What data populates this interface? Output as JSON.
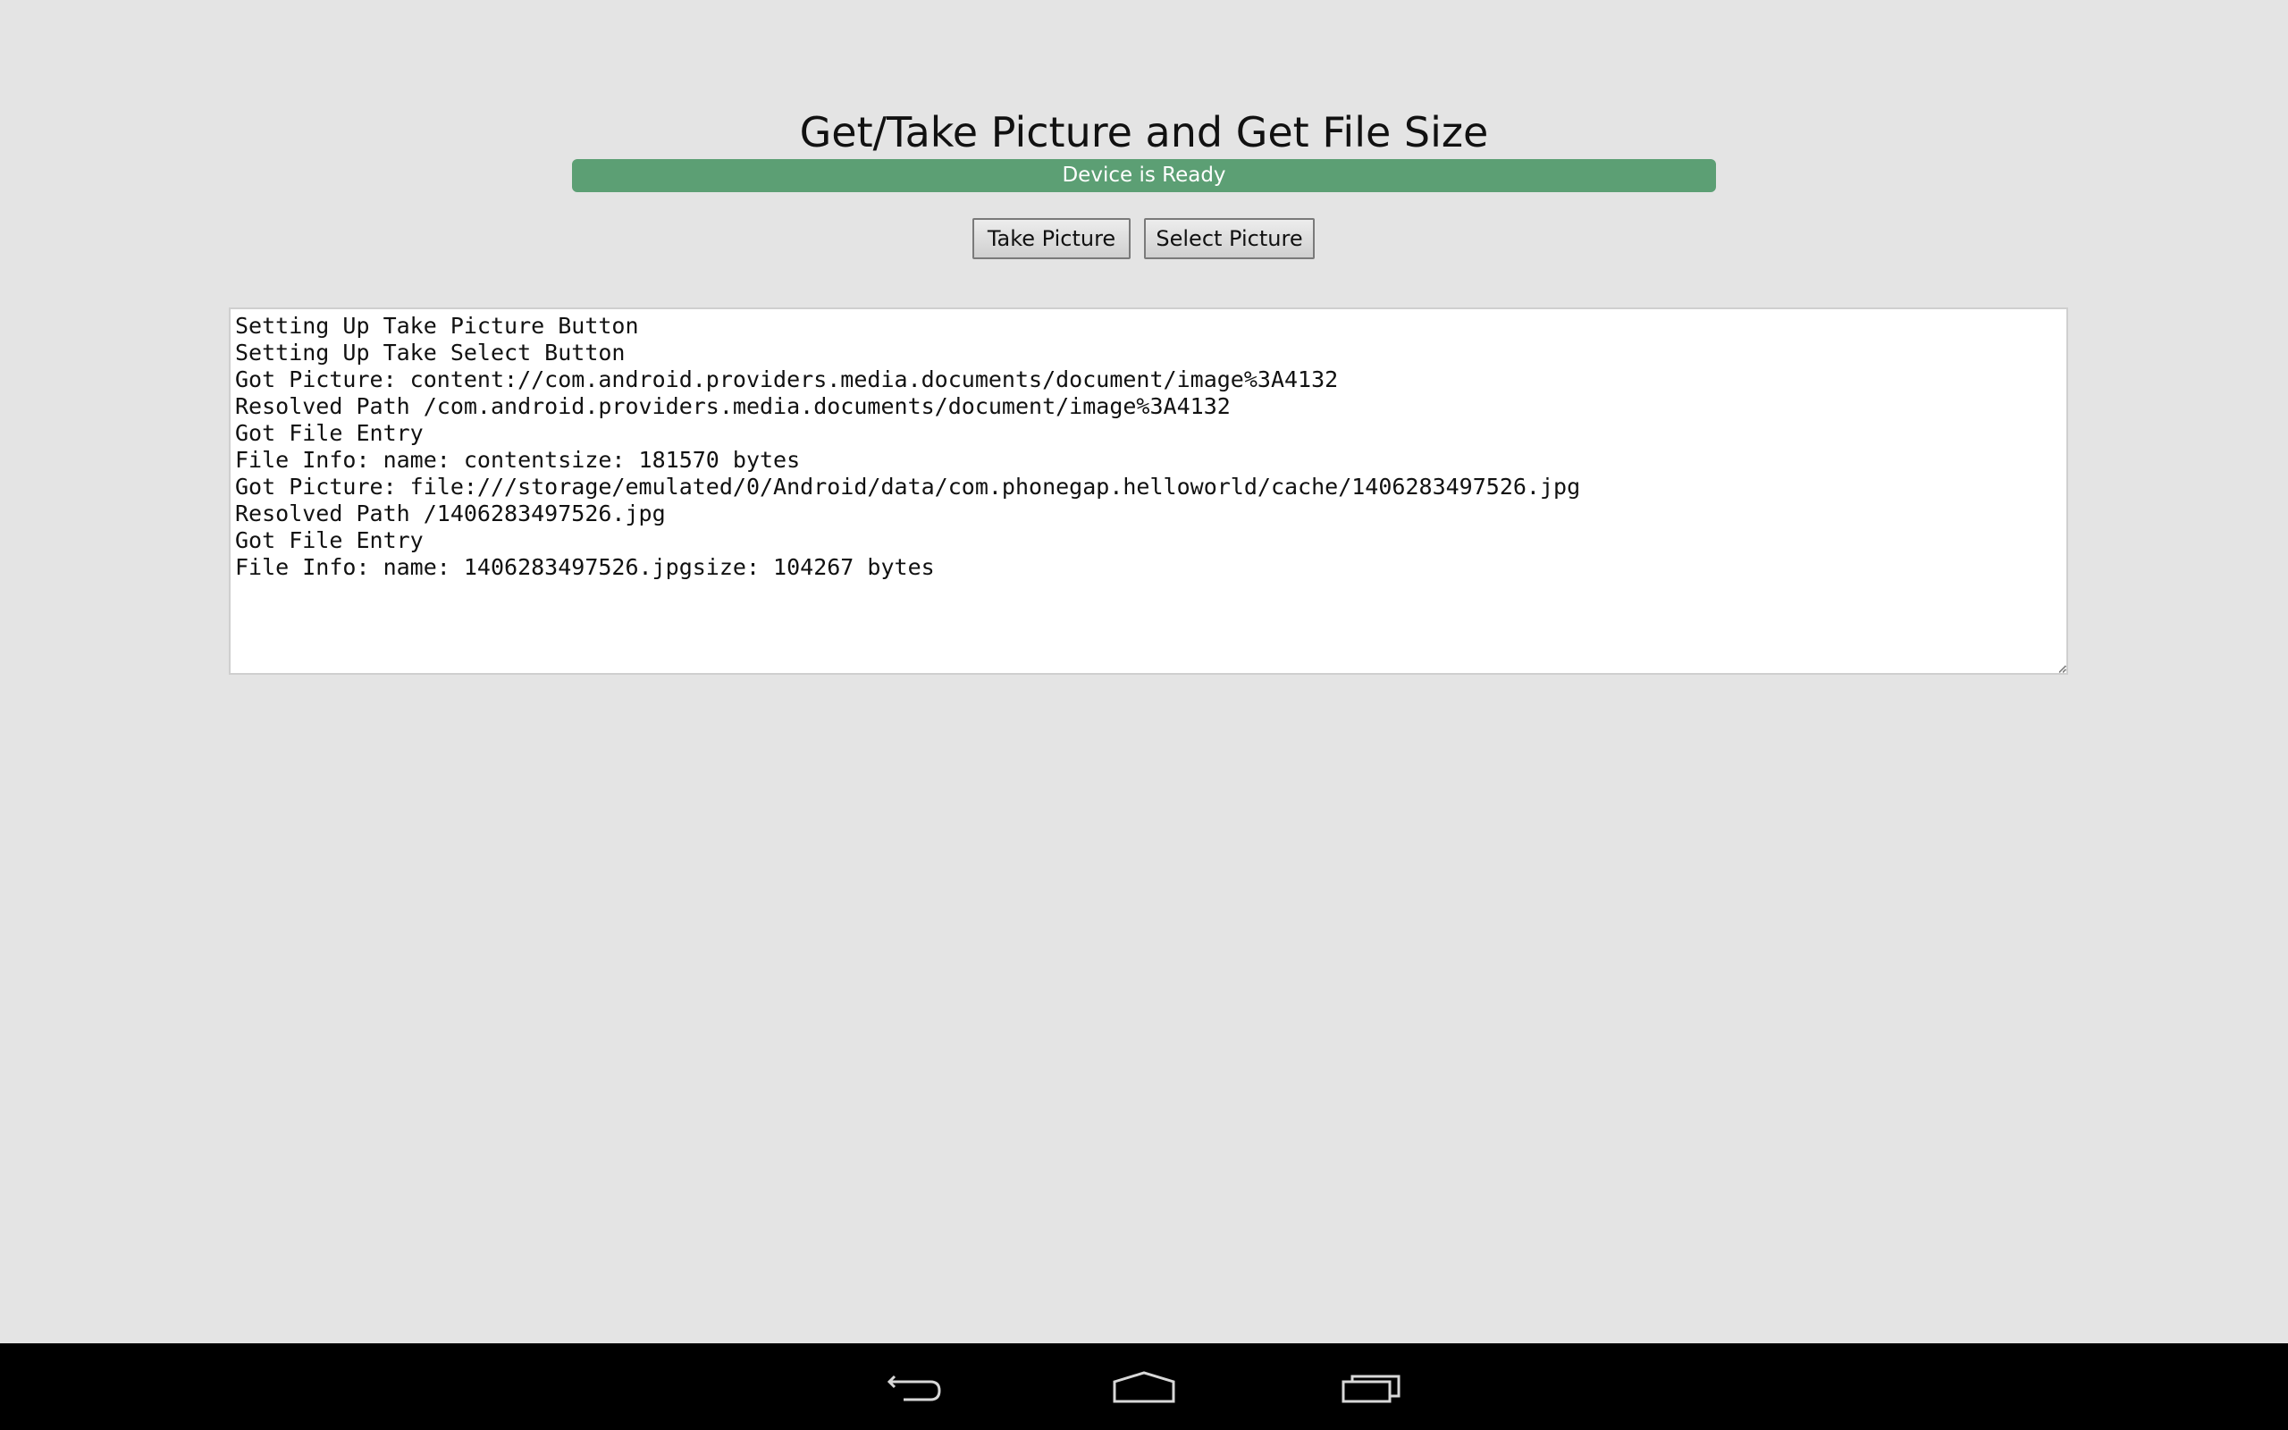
{
  "app": {
    "title": "Get/Take Picture and Get File Size",
    "status": "Device is Ready",
    "status_color": "#5c9f74",
    "buttons": {
      "take_picture": "Take Picture",
      "select_picture": "Select Picture"
    },
    "log_lines": [
      "Setting Up Take Picture Button",
      "Setting Up Take Select Button",
      "Got Picture: content://com.android.providers.media.documents/document/image%3A4132",
      "Resolved Path /com.android.providers.media.documents/document/image%3A4132",
      "Got File Entry",
      "File Info: name: contentsize: 181570 bytes",
      "Got Picture: file:///storage/emulated/0/Android/data/com.phonegap.helloworld/cache/1406283497526.jpg",
      "Resolved Path /1406283497526.jpg",
      "Got File Entry",
      "File Info: name: 1406283497526.jpgsize: 104267 bytes"
    ]
  },
  "navbar": {
    "icons": [
      "back-icon",
      "home-icon",
      "recent-apps-icon"
    ]
  }
}
